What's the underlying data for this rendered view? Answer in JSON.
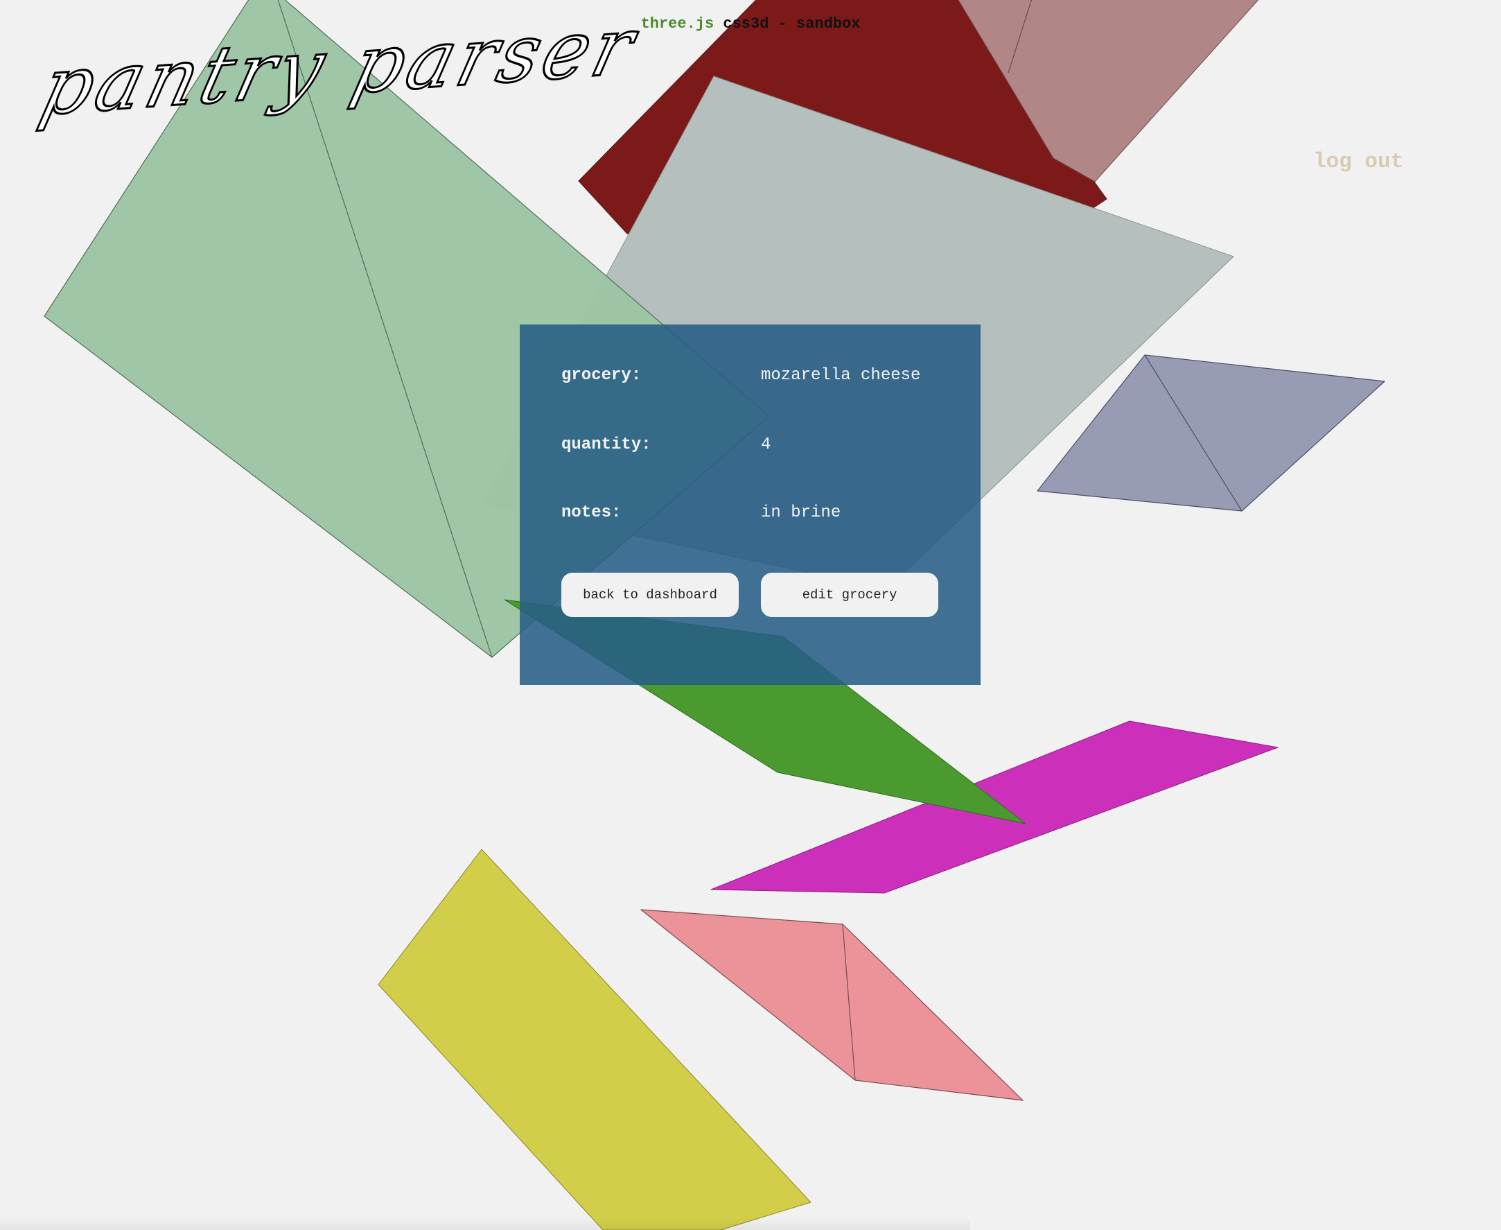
{
  "header": {
    "library": "three.js",
    "rest": " css3d - sandbox"
  },
  "logo": {
    "text": "pantry parser"
  },
  "nav": {
    "logout": "log out"
  },
  "grocery_panel": {
    "rows": [
      {
        "label": "grocery:",
        "value": "mozarella cheese"
      },
      {
        "label": "quantity:",
        "value": "4"
      },
      {
        "label": "notes:",
        "value": "in brine"
      }
    ],
    "back_button": "back to dashboard",
    "edit_button": "edit grocery"
  },
  "colors": {
    "background": "#f1f1f1",
    "panel": "#275d85",
    "library_accent": "#4a8a2c",
    "logout": "#d8cbb4",
    "shape_green": "#9cc4a3",
    "shape_darkred": "#7c1a1a",
    "shape_rose": "#b18687",
    "shape_gray": "#b5bfbe",
    "shape_lavender": "#979bb3",
    "shape_leaf": "#4a9a30",
    "shape_magenta": "#cc30bb",
    "shape_pink": "#ec939a",
    "shape_yellow": "#d3ce49"
  }
}
